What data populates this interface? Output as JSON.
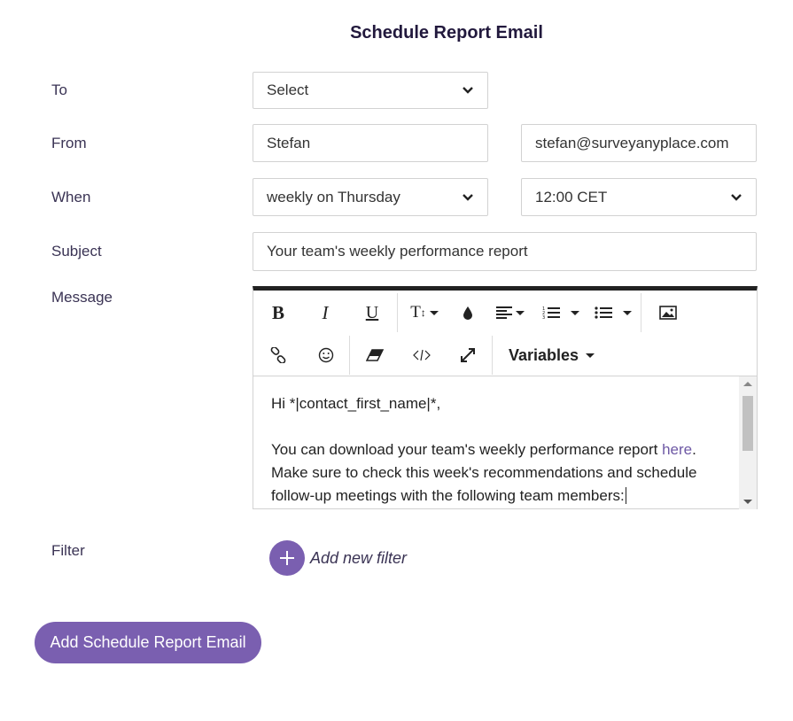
{
  "page": {
    "title": "Schedule Report Email"
  },
  "form": {
    "to": {
      "label": "To",
      "value": "Select"
    },
    "from": {
      "label": "From",
      "name": "Stefan",
      "email": "stefan@surveyanyplace.com"
    },
    "when": {
      "label": "When",
      "frequency": "weekly on Thursday",
      "time": "12:00 CET"
    },
    "subject": {
      "label": "Subject",
      "value": "Your team's weekly performance report"
    },
    "message": {
      "label": "Message",
      "toolbar": {
        "variables_label": "Variables",
        "icons": [
          "bold-icon",
          "italic-icon",
          "underline-icon",
          "font-size-icon",
          "color-drop-icon",
          "align-icon",
          "ordered-list-icon",
          "unordered-list-icon",
          "image-icon",
          "link-icon",
          "emoji-icon",
          "eraser-icon",
          "code-icon",
          "fullscreen-icon"
        ]
      },
      "greeting": "Hi *|contact_first_name|*,",
      "body_before_link": "You can download your team's weekly performance report ",
      "link_text": "here",
      "body_after_link": ".",
      "body_line2": "Make sure to check this week's recommendations and schedule follow-up meetings with the following team members:"
    },
    "filter": {
      "label": "Filter",
      "add_label": "Add new filter"
    }
  },
  "actions": {
    "submit_label": "Add Schedule Report Email"
  },
  "colors": {
    "accent": "#7a5fb0",
    "link": "#6e59a5",
    "title": "#22193d"
  }
}
